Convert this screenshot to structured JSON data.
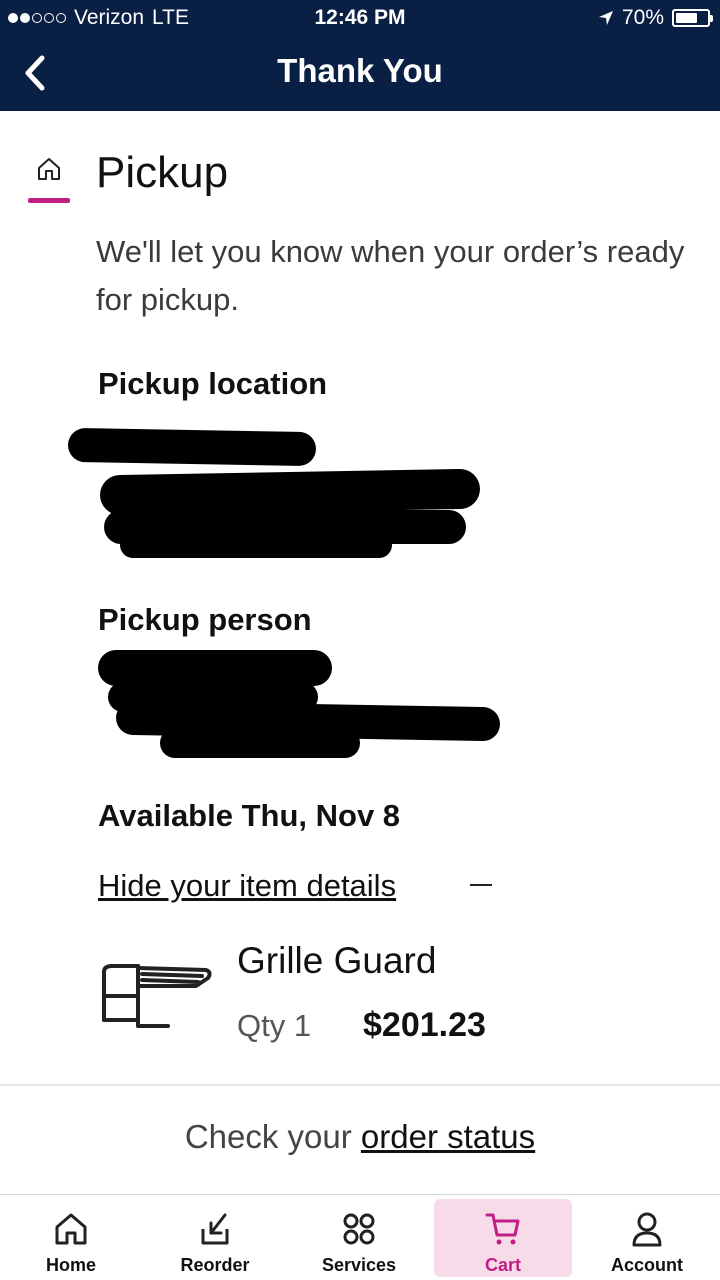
{
  "status_bar": {
    "carrier": "Verizon",
    "network": "LTE",
    "time": "12:46 PM",
    "battery": "70%",
    "battery_level": 0.7,
    "signal_bars_filled": 2,
    "signal_bars_total": 5
  },
  "nav": {
    "title": "Thank You",
    "back_icon": "chevron-left-icon"
  },
  "pickup": {
    "heading": "Pickup",
    "icon": "home-icon",
    "accent_color": "#c21e84",
    "message": "We'll let you know when your order’s ready for pickup.",
    "location_title": "Pickup location",
    "person_title": "Pickup person",
    "available": "Available Thu, Nov 8",
    "toggle_details": "Hide your item details"
  },
  "item": {
    "name": "Grille Guard",
    "qty": "Qty 1",
    "price": "$201.23"
  },
  "footer": {
    "prefix": "Check your ",
    "link": "order status"
  },
  "tabs": [
    {
      "label": "Home",
      "icon": "home-icon"
    },
    {
      "label": "Reorder",
      "icon": "reorder-icon"
    },
    {
      "label": "Services",
      "icon": "services-icon"
    },
    {
      "label": "Cart",
      "icon": "cart-icon",
      "active": true
    },
    {
      "label": "Account",
      "icon": "account-icon"
    }
  ],
  "colors": {
    "nav_bg": "#0a1f44",
    "accent": "#c21e84",
    "active_tab_bg": "#f7dbe9"
  }
}
